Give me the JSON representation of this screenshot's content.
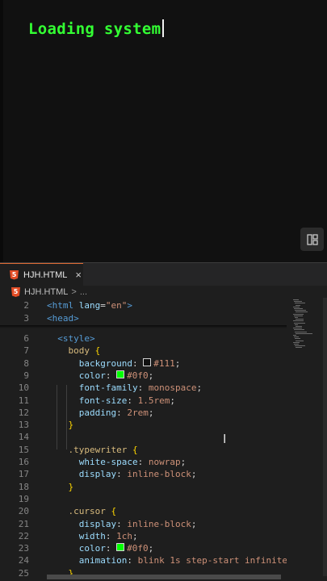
{
  "preview": {
    "typewriter_text": "Loading system"
  },
  "editor": {
    "tab": {
      "label": "HJH.HTML",
      "close": "×"
    },
    "breadcrumb": {
      "file": "HJH.HTML",
      "sep": ">",
      "ellipsis": "..."
    },
    "lines": [
      {
        "n": "2",
        "segs": [
          [
            "tag",
            "<html "
          ],
          [
            "attr",
            "lang"
          ],
          [
            "punc",
            "="
          ],
          [
            "str",
            "\"en\""
          ],
          [
            "tag",
            ">"
          ]
        ]
      },
      {
        "n": "3",
        "segs": [
          [
            "tag",
            "<head>"
          ]
        ]
      },
      {
        "n": "6",
        "segs": [
          [
            "punc",
            "  "
          ],
          [
            "tag",
            "<style>"
          ]
        ]
      },
      {
        "n": "7",
        "segs": [
          [
            "punc",
            "    "
          ],
          [
            "sel",
            "body"
          ],
          [
            "punc",
            " "
          ],
          [
            "brace",
            "{"
          ]
        ]
      },
      {
        "n": "8",
        "segs": [
          [
            "punc",
            "      "
          ],
          [
            "prop",
            "background"
          ],
          [
            "punc",
            ": "
          ],
          [
            "swatch",
            "#111111"
          ],
          [
            "val",
            "#111"
          ],
          [
            "punc",
            ";"
          ]
        ]
      },
      {
        "n": "9",
        "segs": [
          [
            "punc",
            "      "
          ],
          [
            "prop",
            "color"
          ],
          [
            "punc",
            ": "
          ],
          [
            "swatch",
            "#00ff00"
          ],
          [
            "val",
            "#0f0"
          ],
          [
            "punc",
            ";"
          ]
        ]
      },
      {
        "n": "10",
        "segs": [
          [
            "punc",
            "      "
          ],
          [
            "prop",
            "font-family"
          ],
          [
            "punc",
            ": "
          ],
          [
            "val",
            "monospace"
          ],
          [
            "punc",
            ";"
          ]
        ]
      },
      {
        "n": "11",
        "segs": [
          [
            "punc",
            "      "
          ],
          [
            "prop",
            "font-size"
          ],
          [
            "punc",
            ": "
          ],
          [
            "val",
            "1.5rem"
          ],
          [
            "punc",
            ";"
          ]
        ]
      },
      {
        "n": "12",
        "segs": [
          [
            "punc",
            "      "
          ],
          [
            "prop",
            "padding"
          ],
          [
            "punc",
            ": "
          ],
          [
            "val",
            "2rem"
          ],
          [
            "punc",
            ";"
          ]
        ]
      },
      {
        "n": "13",
        "segs": [
          [
            "punc",
            "    "
          ],
          [
            "brace",
            "}"
          ]
        ]
      },
      {
        "n": "14",
        "segs": []
      },
      {
        "n": "15",
        "segs": [
          [
            "punc",
            "    "
          ],
          [
            "sel",
            ".typewriter"
          ],
          [
            "punc",
            " "
          ],
          [
            "brace",
            "{"
          ]
        ]
      },
      {
        "n": "16",
        "segs": [
          [
            "punc",
            "      "
          ],
          [
            "prop",
            "white-space"
          ],
          [
            "punc",
            ": "
          ],
          [
            "val",
            "nowrap"
          ],
          [
            "punc",
            ";"
          ]
        ]
      },
      {
        "n": "17",
        "segs": [
          [
            "punc",
            "      "
          ],
          [
            "prop",
            "display"
          ],
          [
            "punc",
            ": "
          ],
          [
            "val",
            "inline-block"
          ],
          [
            "punc",
            ";"
          ]
        ]
      },
      {
        "n": "18",
        "segs": [
          [
            "punc",
            "    "
          ],
          [
            "brace",
            "}"
          ]
        ]
      },
      {
        "n": "19",
        "segs": []
      },
      {
        "n": "20",
        "segs": [
          [
            "punc",
            "    "
          ],
          [
            "sel",
            ".cursor"
          ],
          [
            "punc",
            " "
          ],
          [
            "brace",
            "{"
          ]
        ]
      },
      {
        "n": "21",
        "segs": [
          [
            "punc",
            "      "
          ],
          [
            "prop",
            "display"
          ],
          [
            "punc",
            ": "
          ],
          [
            "val",
            "inline-block"
          ],
          [
            "punc",
            ";"
          ]
        ]
      },
      {
        "n": "22",
        "segs": [
          [
            "punc",
            "      "
          ],
          [
            "prop",
            "width"
          ],
          [
            "punc",
            ": "
          ],
          [
            "val",
            "1ch"
          ],
          [
            "punc",
            ";"
          ]
        ]
      },
      {
        "n": "23",
        "segs": [
          [
            "punc",
            "      "
          ],
          [
            "prop",
            "color"
          ],
          [
            "punc",
            ": "
          ],
          [
            "swatch",
            "#00ff00"
          ],
          [
            "val",
            "#0f0"
          ],
          [
            "punc",
            ";"
          ]
        ]
      },
      {
        "n": "24",
        "segs": [
          [
            "punc",
            "      "
          ],
          [
            "prop",
            "animation"
          ],
          [
            "punc",
            ": "
          ],
          [
            "val",
            "blink 1s step-start infinite"
          ],
          [
            "punc",
            ";"
          ]
        ]
      },
      {
        "n": "25",
        "segs": [
          [
            "punc",
            "    "
          ],
          [
            "brace",
            "}"
          ]
        ]
      }
    ]
  },
  "colors": {
    "typewriter": "#33ff33",
    "editor_bg": "#1e1e1e",
    "tab_accent": "#e06b35",
    "html5": "#e44d26"
  },
  "icons": {
    "layout": "layout-toggle-icon",
    "file": "html5-icon"
  }
}
